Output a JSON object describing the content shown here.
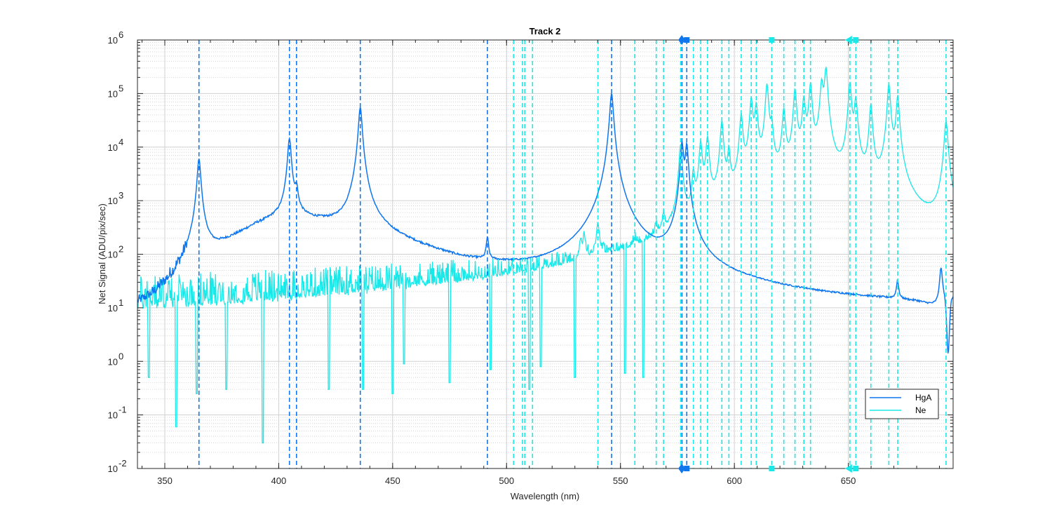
{
  "chart_data": {
    "type": "line",
    "title": "Track 2",
    "xlabel": "Wavelength (nm)",
    "ylabel": "Net Signal (ADU/pix/sec)",
    "xlim": [
      338,
      696
    ],
    "ylim": [
      0.01,
      1000000
    ],
    "yscale": "log",
    "grid": true,
    "legend_position": "bottom-right",
    "x_ticks": [
      350,
      400,
      450,
      500,
      550,
      600,
      650
    ],
    "y_tick_bases": [
      "10",
      "10",
      "10",
      "10",
      "10",
      "10",
      "10",
      "10",
      "10"
    ],
    "y_tick_exponents": [
      "-2",
      "-1",
      "0",
      "1",
      "2",
      "3",
      "4",
      "5",
      "6"
    ],
    "colors": {
      "HgA": "#0f76ee",
      "Ne": "#19e8e8",
      "axis": "#262626",
      "grid": "#d9d9d9"
    },
    "series": [
      {
        "name": "HgA",
        "color": "#0f76ee",
        "background": [
          [
            338,
            3.5
          ],
          [
            345,
            6
          ],
          [
            352,
            16
          ],
          [
            358,
            40
          ],
          [
            362,
            85
          ],
          [
            366,
            110
          ],
          [
            372,
            130
          ],
          [
            380,
            200
          ],
          [
            390,
            340
          ],
          [
            398,
            440
          ],
          [
            404,
            480
          ],
          [
            410,
            450
          ],
          [
            420,
            380
          ],
          [
            430,
            300
          ],
          [
            436,
            500
          ],
          [
            440,
            250
          ],
          [
            450,
            180
          ],
          [
            460,
            130
          ],
          [
            470,
            95
          ],
          [
            480,
            70
          ],
          [
            490,
            58
          ],
          [
            500,
            48
          ],
          [
            510,
            40
          ],
          [
            520,
            36
          ],
          [
            530,
            33
          ],
          [
            540,
            30
          ],
          [
            546,
            32
          ],
          [
            556,
            27
          ],
          [
            565,
            25
          ],
          [
            576,
            35
          ],
          [
            580,
            28
          ],
          [
            590,
            21
          ],
          [
            600,
            18
          ],
          [
            610,
            16
          ],
          [
            620,
            14
          ],
          [
            630,
            13
          ],
          [
            640,
            12
          ],
          [
            650,
            11.5
          ],
          [
            660,
            11
          ],
          [
            670,
            10.5
          ],
          [
            680,
            9.5
          ],
          [
            690,
            7
          ],
          [
            696,
            12
          ]
        ],
        "peaks": [
          {
            "x": 365.0,
            "y": 6000,
            "w": 0.7
          },
          {
            "x": 404.7,
            "y": 14000,
            "w": 0.7
          },
          {
            "x": 407.8,
            "y": 1100,
            "w": 0.6
          },
          {
            "x": 435.8,
            "y": 55000,
            "w": 0.7
          },
          {
            "x": 491.6,
            "y": 130,
            "w": 0.5
          },
          {
            "x": 546.1,
            "y": 100000,
            "w": 0.7
          },
          {
            "x": 577.0,
            "y": 12000,
            "w": 0.6
          },
          {
            "x": 579.1,
            "y": 11000,
            "w": 0.6
          },
          {
            "x": 671.6,
            "y": 18,
            "w": 0.5
          },
          {
            "x": 690.7,
            "y": 45,
            "w": 0.6
          }
        ],
        "dips": [
          {
            "x": 693.8,
            "y": 1.4,
            "w": 0.8
          }
        ]
      },
      {
        "name": "Ne",
        "color": "#19e8e8",
        "noise_baseline": [
          [
            338,
            8
          ],
          [
            400,
            10
          ],
          [
            450,
            12
          ],
          [
            500,
            12
          ],
          [
            540,
            15
          ],
          [
            565,
            20
          ],
          [
            576,
            30
          ],
          [
            585,
            180
          ],
          [
            600,
            200
          ],
          [
            620,
            180
          ],
          [
            640,
            150
          ],
          [
            660,
            120
          ],
          [
            675,
            100
          ],
          [
            682,
            60
          ],
          [
            690,
            40
          ],
          [
            696,
            30
          ]
        ],
        "peaks": [
          {
            "x": 532.6,
            "y": 110,
            "w": 0.5
          },
          {
            "x": 534.1,
            "y": 150,
            "w": 0.5
          },
          {
            "x": 540.1,
            "y": 300,
            "w": 0.6
          },
          {
            "x": 556.3,
            "y": 50,
            "w": 0.5
          },
          {
            "x": 565.7,
            "y": 150,
            "w": 0.5
          },
          {
            "x": 568.9,
            "y": 300,
            "w": 0.5
          },
          {
            "x": 576.4,
            "y": 11000,
            "w": 0.6
          },
          {
            "x": 582.0,
            "y": 3000,
            "w": 0.5
          },
          {
            "x": 585.2,
            "y": 12000,
            "w": 0.6
          },
          {
            "x": 588.2,
            "y": 15000,
            "w": 0.6
          },
          {
            "x": 594.5,
            "y": 30000,
            "w": 0.6
          },
          {
            "x": 597.6,
            "y": 8000,
            "w": 0.5
          },
          {
            "x": 603.0,
            "y": 40000,
            "w": 0.6
          },
          {
            "x": 607.4,
            "y": 80000,
            "w": 0.6
          },
          {
            "x": 609.6,
            "y": 60000,
            "w": 0.6
          },
          {
            "x": 614.3,
            "y": 150000,
            "w": 0.6
          },
          {
            "x": 616.4,
            "y": 25000,
            "w": 0.5
          },
          {
            "x": 621.7,
            "y": 50000,
            "w": 0.6
          },
          {
            "x": 626.6,
            "y": 120000,
            "w": 0.6
          },
          {
            "x": 630.5,
            "y": 80000,
            "w": 0.6
          },
          {
            "x": 633.4,
            "y": 150000,
            "w": 0.6
          },
          {
            "x": 638.3,
            "y": 160000,
            "w": 0.6
          },
          {
            "x": 640.2,
            "y": 300000,
            "w": 0.6
          },
          {
            "x": 650.7,
            "y": 160000,
            "w": 0.6
          },
          {
            "x": 653.3,
            "y": 80000,
            "w": 0.6
          },
          {
            "x": 659.9,
            "y": 60000,
            "w": 0.6
          },
          {
            "x": 667.8,
            "y": 150000,
            "w": 0.6
          },
          {
            "x": 671.7,
            "y": 90000,
            "w": 0.6
          },
          {
            "x": 692.9,
            "y": 30000,
            "w": 0.7
          }
        ],
        "deep_dips": [
          [
            343,
            0.5
          ],
          [
            355,
            0.06
          ],
          [
            364,
            0.25
          ],
          [
            377,
            0.3
          ],
          [
            393,
            0.03
          ],
          [
            422,
            0.3
          ],
          [
            437,
            0.3
          ],
          [
            450,
            0.25
          ],
          [
            455,
            0.9
          ],
          [
            475,
            0.4
          ],
          [
            493,
            0.7
          ],
          [
            510,
            0.3
          ],
          [
            515,
            0.8
          ],
          [
            530,
            0.5
          ],
          [
            552,
            0.6
          ],
          [
            560,
            0.5
          ]
        ]
      }
    ],
    "reference_lines": {
      "HgA": [
        365.0,
        404.7,
        407.8,
        435.8,
        491.6,
        546.1,
        577.0,
        579.1
      ],
      "Ne": [
        503.1,
        507.0,
        508.0,
        511.4,
        540.1,
        556.3,
        565.7,
        568.9,
        576.4,
        582.0,
        585.2,
        588.2,
        594.5,
        597.6,
        603.0,
        607.4,
        609.6,
        616.4,
        621.7,
        626.6,
        630.5,
        633.4,
        650.7,
        653.3,
        659.9,
        667.8,
        671.7,
        692.9
      ]
    },
    "markers": [
      {
        "series": "HgA",
        "x": 576.9,
        "shape": "diamond"
      },
      {
        "series": "HgA",
        "x": 579.1,
        "shape": "square"
      },
      {
        "series": "Ne",
        "x": 616.4,
        "shape": "square"
      },
      {
        "series": "Ne",
        "x": 650.7,
        "shape": "triangle-left"
      },
      {
        "series": "Ne",
        "x": 653.3,
        "shape": "square"
      }
    ],
    "legend": [
      {
        "label": "HgA",
        "color": "#0f76ee"
      },
      {
        "label": "Ne",
        "color": "#19e8e8"
      }
    ]
  }
}
